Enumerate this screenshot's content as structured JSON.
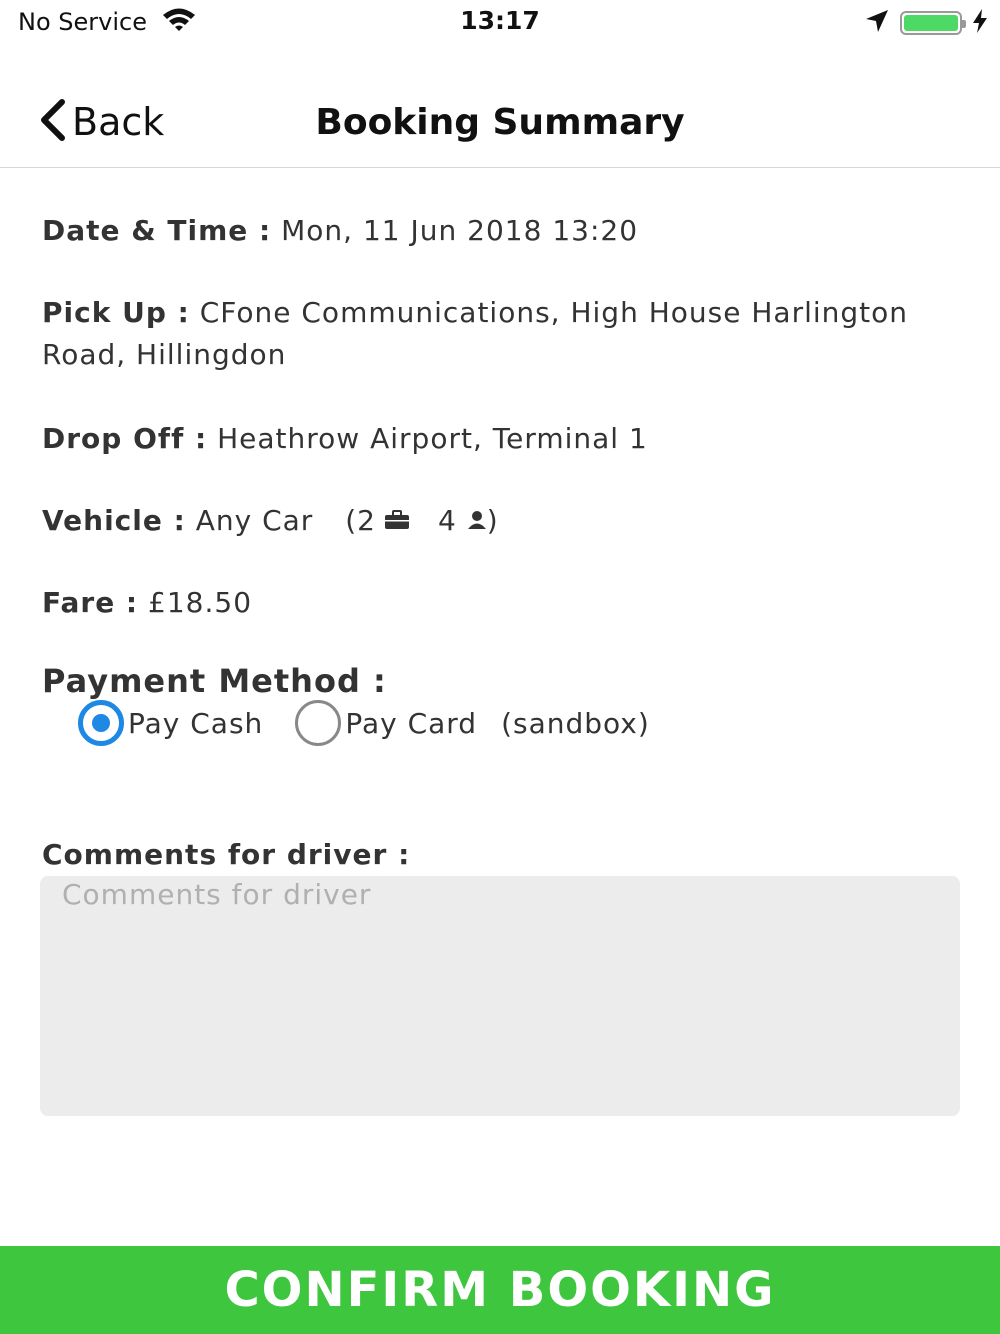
{
  "status_bar": {
    "carrier": "No Service",
    "time": "13:17"
  },
  "nav": {
    "back_label": "Back",
    "title": "Booking Summary"
  },
  "details": {
    "datetime_label": "Date & Time :",
    "datetime_value": "Mon, 11 Jun 2018 13:20",
    "pickup_label": "Pick Up :",
    "pickup_value": "CFone Communications, High House Harlington Road, Hillingdon",
    "dropoff_label": "Drop Off :",
    "dropoff_value": "Heathrow Airport, Terminal 1",
    "vehicle_label": "Vehicle :",
    "vehicle_value": "Any Car",
    "vehicle_luggage": "2",
    "vehicle_passengers": "4",
    "fare_label": "Fare :",
    "fare_value": "£18.50"
  },
  "payment": {
    "title": "Payment Method :",
    "option_cash": "Pay Cash",
    "option_card": "Pay Card",
    "card_note": "(sandbox)",
    "selected": "cash"
  },
  "comments": {
    "label": "Comments for driver :",
    "placeholder": "Comments for driver",
    "value": ""
  },
  "confirm_label": "CONFIRM BOOKING",
  "colors": {
    "accent_green": "#3ec63e",
    "radio_blue": "#1e88e5",
    "battery_green": "#4cd964"
  }
}
